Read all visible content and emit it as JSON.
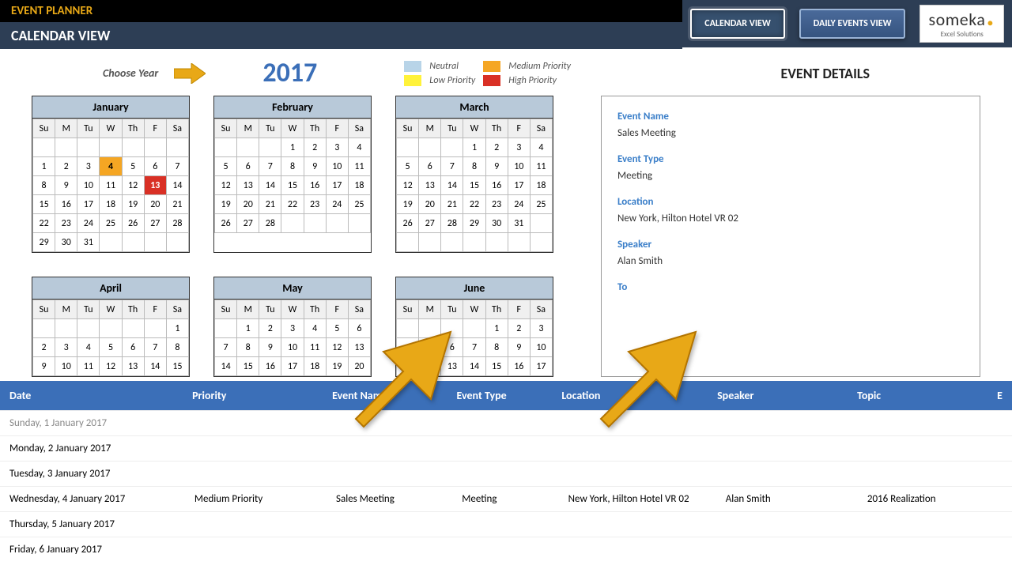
{
  "header": {
    "app_title": "EVENT PLANNER",
    "view_title": "CALENDAR VIEW",
    "nav": {
      "calendar": "CALENDAR VIEW",
      "daily": "DAILY EVENTS VIEW"
    },
    "logo": {
      "main": "someka",
      "sub": "Excel Solutions"
    }
  },
  "controls": {
    "choose_year": "Choose Year",
    "year": "2017",
    "legend": {
      "neutral": "Neutral",
      "low": "Low Priority",
      "medium": "Medium Priority",
      "high": "High Priority"
    }
  },
  "details": {
    "title": "EVENT DETAILS",
    "fields": {
      "name_label": "Event Name",
      "name_value": "Sales Meeting",
      "type_label": "Event Type",
      "type_value": "Meeting",
      "loc_label": "Location",
      "loc_value": "New York, Hilton Hotel VR 02",
      "speaker_label": "Speaker",
      "speaker_value": "Alan Smith",
      "topic_label": "To"
    }
  },
  "months": {
    "jan": "January",
    "feb": "February",
    "mar": "March",
    "apr": "April",
    "may": "May",
    "jun": "June"
  },
  "dow": [
    "Su",
    "M",
    "Tu",
    "W",
    "Th",
    "F",
    "Sa"
  ],
  "cal_data": {
    "jan": [
      [
        "",
        "",
        "",
        "",
        "",
        "",
        ""
      ],
      [
        "1",
        "2",
        "3",
        "4",
        "5",
        "6",
        "7"
      ],
      [
        "8",
        "9",
        "10",
        "11",
        "12",
        "13",
        "14"
      ],
      [
        "15",
        "16",
        "17",
        "18",
        "19",
        "20",
        "21"
      ],
      [
        "22",
        "23",
        "24",
        "25",
        "26",
        "27",
        "28"
      ],
      [
        "29",
        "30",
        "31",
        "",
        "",
        "",
        ""
      ]
    ],
    "feb": [
      [
        "",
        "",
        "",
        "1",
        "2",
        "3",
        "4"
      ],
      [
        "5",
        "6",
        "7",
        "8",
        "9",
        "10",
        "11"
      ],
      [
        "12",
        "13",
        "14",
        "15",
        "16",
        "17",
        "18"
      ],
      [
        "19",
        "20",
        "21",
        "22",
        "23",
        "24",
        "25"
      ],
      [
        "26",
        "27",
        "28",
        "",
        "",
        "",
        ""
      ]
    ],
    "mar": [
      [
        "",
        "",
        "",
        "1",
        "2",
        "3",
        "4"
      ],
      [
        "5",
        "6",
        "7",
        "8",
        "9",
        "10",
        "11"
      ],
      [
        "12",
        "13",
        "14",
        "15",
        "16",
        "17",
        "18"
      ],
      [
        "19",
        "20",
        "21",
        "22",
        "23",
        "24",
        "25"
      ],
      [
        "26",
        "27",
        "28",
        "29",
        "30",
        "31",
        ""
      ],
      [
        "",
        "",
        "",
        "",
        "",
        "",
        ""
      ]
    ],
    "apr": [
      [
        "",
        "",
        "",
        "",
        "",
        "",
        "1"
      ],
      [
        "2",
        "3",
        "4",
        "5",
        "6",
        "7",
        "8"
      ],
      [
        "9",
        "10",
        "11",
        "12",
        "13",
        "14",
        "15"
      ]
    ],
    "may": [
      [
        "",
        "1",
        "2",
        "3",
        "4",
        "5",
        "6"
      ],
      [
        "7",
        "8",
        "9",
        "10",
        "11",
        "12",
        "13"
      ],
      [
        "14",
        "15",
        "16",
        "17",
        "18",
        "19",
        "20"
      ]
    ],
    "jun": [
      [
        "",
        "",
        "",
        "",
        "1",
        "2",
        "3"
      ],
      [
        "4",
        "5",
        "6",
        "7",
        "8",
        "9",
        "10"
      ],
      [
        "11",
        "12",
        "13",
        "14",
        "15",
        "16",
        "17"
      ]
    ]
  },
  "highlights": {
    "jan": {
      "4": "med",
      "13": "high"
    }
  },
  "table": {
    "head": {
      "date": "Date",
      "priority": "Priority",
      "evname": "Event Name",
      "evtype": "Event Type",
      "loc": "Location",
      "speaker": "Speaker",
      "topic": "Topic",
      "extra": "E"
    },
    "rows": [
      {
        "date": "Sunday, 1 January 2017",
        "dim": true
      },
      {
        "date": "Monday, 2 January 2017"
      },
      {
        "date": "Tuesday, 3 January 2017"
      },
      {
        "date": "Wednesday, 4 January 2017",
        "priority": "Medium Priority",
        "evname": "Sales Meeting",
        "evtype": "Meeting",
        "loc": "New York, Hilton Hotel VR 02",
        "speaker": "Alan Smith",
        "topic": "2016 Realization"
      },
      {
        "date": "Thursday, 5 January 2017"
      },
      {
        "date": "Friday, 6 January 2017"
      }
    ]
  }
}
